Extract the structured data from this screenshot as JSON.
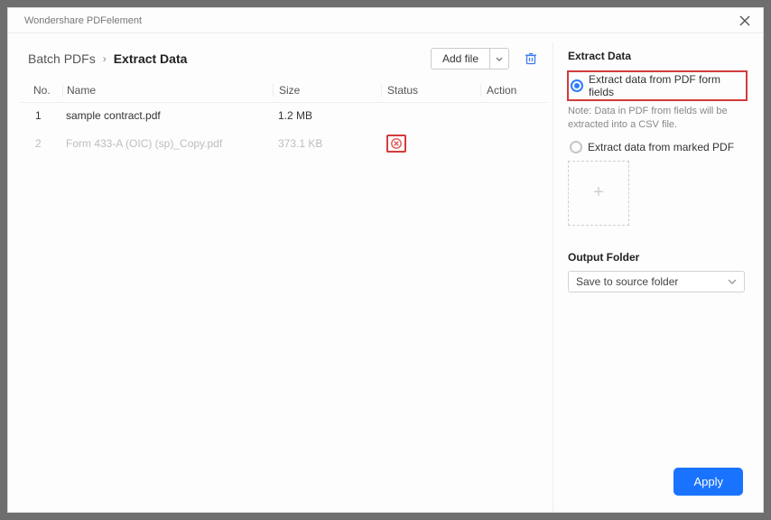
{
  "window": {
    "title": "Wondershare PDFelement"
  },
  "breadcrumb": {
    "root": "Batch PDFs",
    "current": "Extract Data"
  },
  "toolbar": {
    "add_file_label": "Add file"
  },
  "table": {
    "headers": {
      "no": "No.",
      "name": "Name",
      "size": "Size",
      "status": "Status",
      "action": "Action"
    },
    "rows": [
      {
        "no": "1",
        "name": "sample contract.pdf",
        "size": "1.2 MB",
        "status": "",
        "dim": false,
        "error": false
      },
      {
        "no": "2",
        "name": "Form 433-A (OIC) (sp)_Copy.pdf",
        "size": "373.1 KB",
        "status": "",
        "dim": true,
        "error": true
      }
    ]
  },
  "right": {
    "title": "Extract Data",
    "option1": "Extract data from PDF form fields",
    "note": "Note: Data in PDF from fields will be extracted into a CSV file.",
    "option2": "Extract data from marked PDF",
    "output_label": "Output Folder",
    "output_value": "Save to source folder"
  },
  "footer": {
    "apply": "Apply"
  }
}
